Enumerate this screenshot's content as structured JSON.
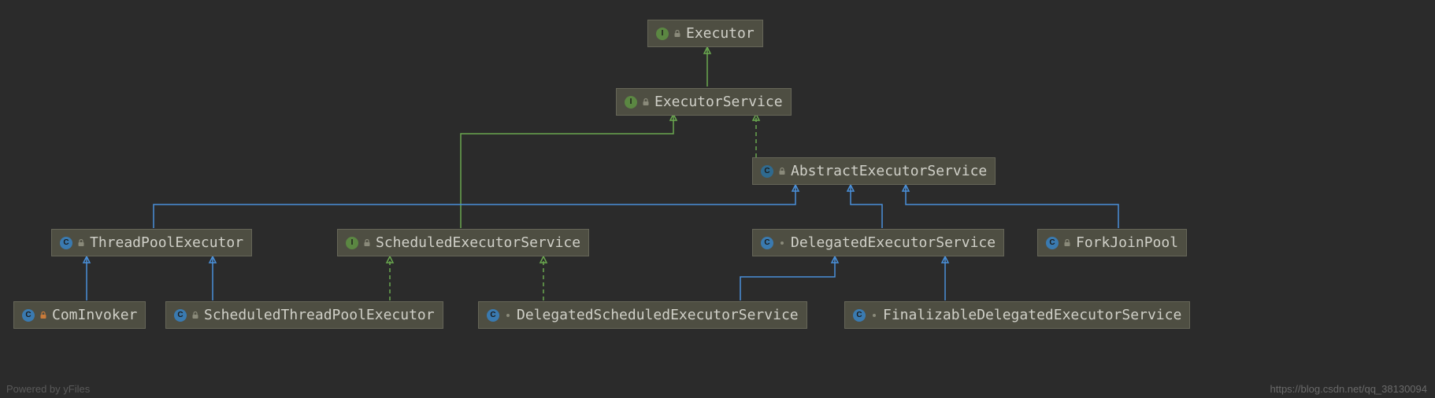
{
  "nodes": {
    "executor": {
      "label": "Executor",
      "kind": "interface"
    },
    "executorService": {
      "label": "ExecutorService",
      "kind": "interface"
    },
    "abstractExecutorService": {
      "label": "AbstractExecutorService",
      "kind": "abstract-class"
    },
    "threadPoolExecutor": {
      "label": "ThreadPoolExecutor",
      "kind": "class"
    },
    "scheduledExecutorService": {
      "label": "ScheduledExecutorService",
      "kind": "interface"
    },
    "delegatedExecutorService": {
      "label": "DelegatedExecutorService",
      "kind": "class-inner"
    },
    "forkJoinPool": {
      "label": "ForkJoinPool",
      "kind": "class"
    },
    "comInvoker": {
      "label": "ComInvoker",
      "kind": "class-locked"
    },
    "scheduledThreadPoolExecutor": {
      "label": "ScheduledThreadPoolExecutor",
      "kind": "class"
    },
    "delegatedScheduledExecutorService": {
      "label": "DelegatedScheduledExecutorService",
      "kind": "class-inner"
    },
    "finalizableDelegatedExecutorService": {
      "label": "FinalizableDelegatedExecutorService",
      "kind": "class-inner"
    }
  },
  "edges": [
    {
      "from": "executorService",
      "to": "executor",
      "rel": "implements-solid"
    },
    {
      "from": "abstractExecutorService",
      "to": "executorService",
      "rel": "implements-dashed"
    },
    {
      "from": "scheduledExecutorService",
      "to": "executorService",
      "rel": "implements-solid"
    },
    {
      "from": "threadPoolExecutor",
      "to": "abstractExecutorService",
      "rel": "extends"
    },
    {
      "from": "delegatedExecutorService",
      "to": "abstractExecutorService",
      "rel": "extends"
    },
    {
      "from": "forkJoinPool",
      "to": "abstractExecutorService",
      "rel": "extends"
    },
    {
      "from": "comInvoker",
      "to": "threadPoolExecutor",
      "rel": "extends"
    },
    {
      "from": "scheduledThreadPoolExecutor",
      "to": "threadPoolExecutor",
      "rel": "extends"
    },
    {
      "from": "scheduledThreadPoolExecutor",
      "to": "scheduledExecutorService",
      "rel": "implements-dashed"
    },
    {
      "from": "delegatedScheduledExecutorService",
      "to": "scheduledExecutorService",
      "rel": "implements-dashed"
    },
    {
      "from": "delegatedScheduledExecutorService",
      "to": "delegatedExecutorService",
      "rel": "extends"
    },
    {
      "from": "finalizableDelegatedExecutorService",
      "to": "delegatedExecutorService",
      "rel": "extends"
    }
  ],
  "watermark": {
    "left": "Powered by yFiles",
    "right": "https://blog.csdn.net/qq_38130094"
  },
  "colors": {
    "extends": "#4a90d9",
    "implements": "#6aa84f",
    "nodeBg": "#4e4e42",
    "bg": "#2b2b2b"
  }
}
